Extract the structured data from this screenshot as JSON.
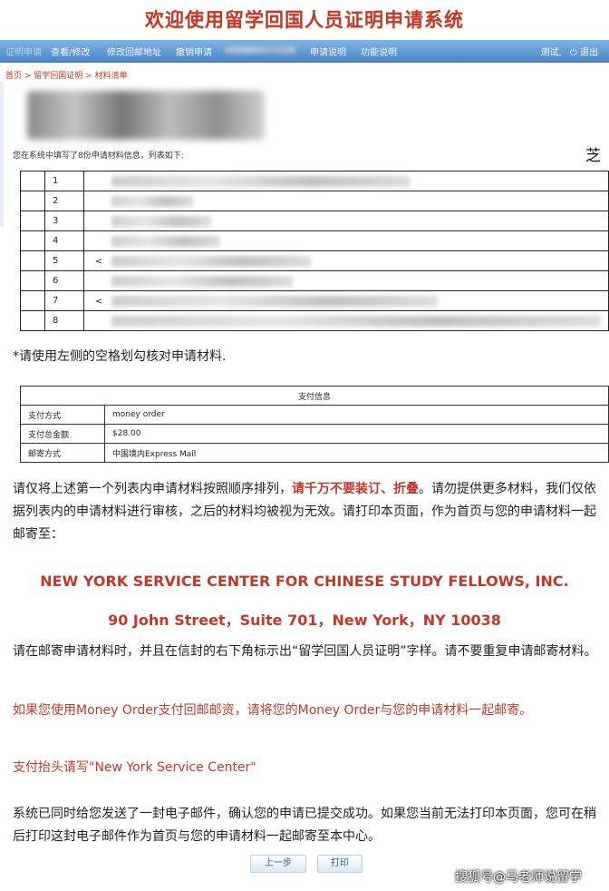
{
  "banner": {
    "title": "欢迎使用留学回国人员证明申请系统"
  },
  "nav": {
    "items": [
      {
        "label": "证明申请"
      },
      {
        "label": "查看/修改"
      },
      {
        "label": "修改回邮地址"
      },
      {
        "label": "撤销申请"
      },
      {
        "label": "申请说明"
      },
      {
        "label": "功能说明"
      }
    ],
    "user": "测试,",
    "logout": "退出"
  },
  "breadcrumb": {
    "home": "首页",
    "level1": "留学回国证明",
    "level2": "材料清单",
    "sep": " > "
  },
  "intro": "您在系统中填写了8份申请材料信息，列表如下:",
  "corner_char": "芝",
  "materials": {
    "rows": [
      {
        "num": "1",
        "prefix": ""
      },
      {
        "num": "2",
        "prefix": ""
      },
      {
        "num": "3",
        "prefix": ""
      },
      {
        "num": "4",
        "prefix": ""
      },
      {
        "num": "5",
        "prefix": "<"
      },
      {
        "num": "6",
        "prefix": ""
      },
      {
        "num": "7",
        "prefix": "<"
      },
      {
        "num": "8",
        "prefix": ""
      }
    ]
  },
  "note": "*请使用左侧的空格划勾核对申请材料.",
  "payment": {
    "header": "支付信息",
    "rows": [
      {
        "label": "支付方式",
        "value": "money order"
      },
      {
        "label": "支付总金额",
        "value": "$28.00"
      },
      {
        "label": "邮寄方式",
        "value": "中国境内Express Mail"
      }
    ]
  },
  "para1": {
    "a": "请仅将上述第一个列表内申请材料按照顺序排列，",
    "b": "请千万不要装订、折叠",
    "c": "。请勿提供更多材料，我们仅依据列表内的申请材料进行审核，之后的材料均被视为无效。请打印本页面，作为首页与您的申请材料一起邮寄至："
  },
  "address": {
    "org": "NEW YORK SERVICE CENTER FOR CHINESE STUDY FELLOWS, INC.",
    "street": "90 John Street，Suite 701，New York，NY 10038"
  },
  "para2": "请在邮寄申请材料时，并且在信封的右下角标示出“留学回国人员证明”字样。请不要重复申请邮寄材料。",
  "para3": "如果您使用Money Order支付回邮邮资，请将您的Money Order与您的申请材料一起邮寄。",
  "para4": "支付抬头请写\"New York Service Center\"",
  "para5": "系统已同时给您发送了一封电子邮件，确认您的申请已提交成功。如果您当前无法打印本页面，您可在稍后打印这封电子邮件作为首页与您的申请材料一起邮寄至本中心。",
  "buttons": {
    "prev": "上一步",
    "print": "打印"
  },
  "watermark": "搜狐号@马老师说留学"
}
